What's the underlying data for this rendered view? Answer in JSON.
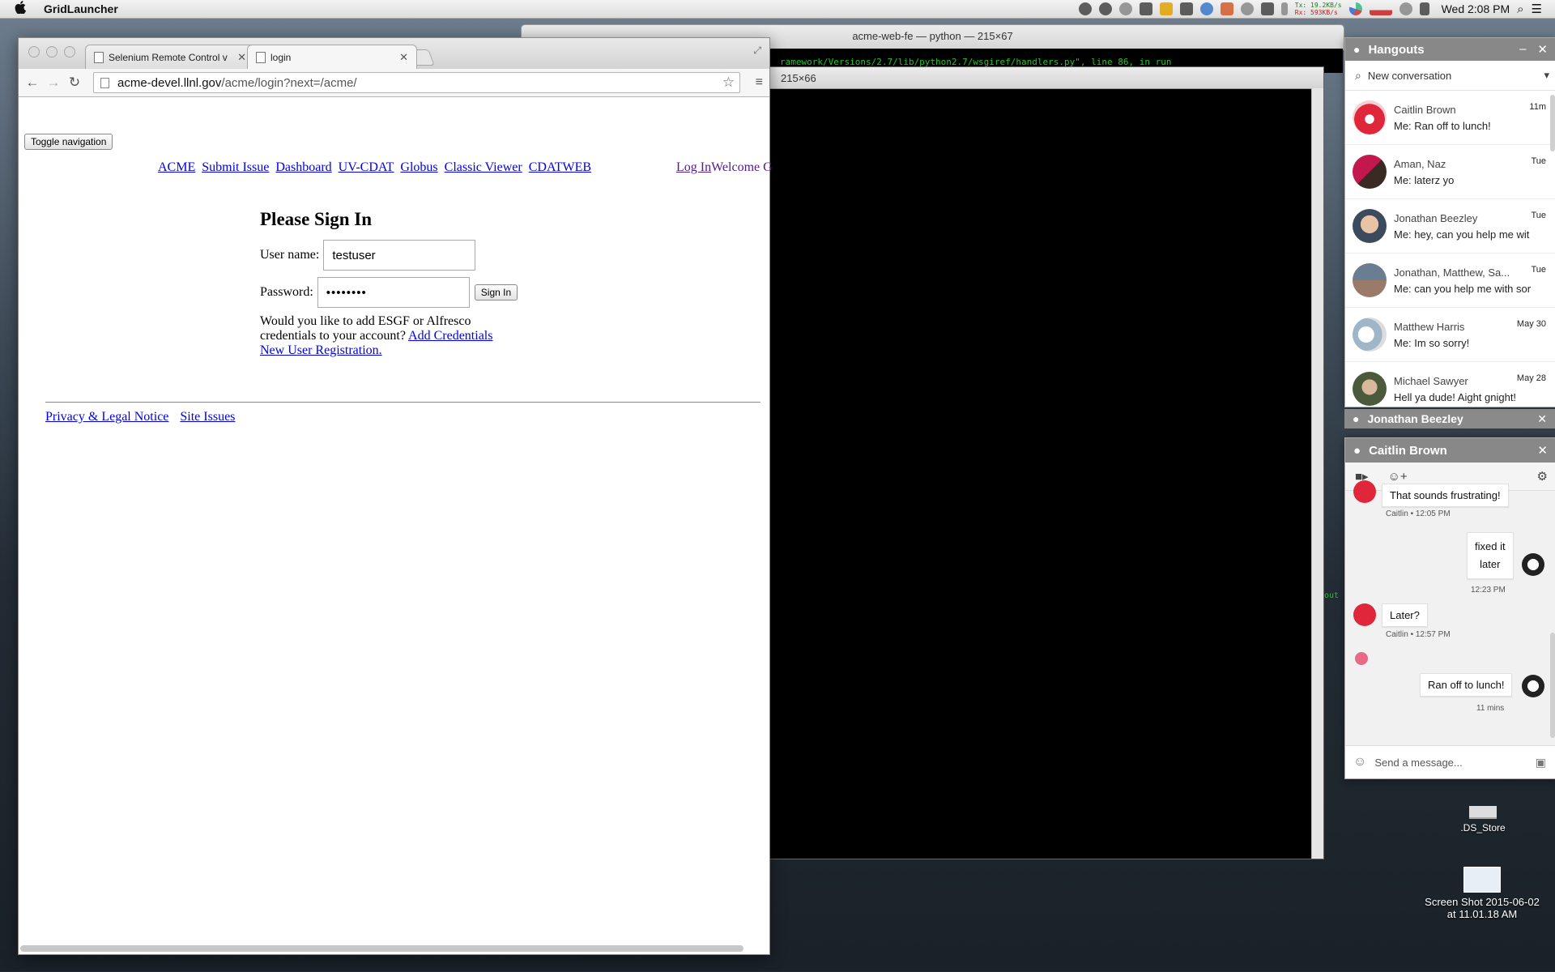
{
  "menubar": {
    "app_name": "GridLauncher",
    "net_tx": "Tx: 19.2KB/s",
    "net_rx": "Rx: 593KB/s",
    "clock": "Wed 2:08 PM"
  },
  "desktop": {
    "ds_store_label": ".DS_Store",
    "screenshot_label_line1": "Screen Shot 2015-06-02",
    "screenshot_label_line2": "at 11.01.18 AM"
  },
  "terminal_back": {
    "title": "acme-web-fe — python — 215×67",
    "line": "ramework/Versions/2.7/lib/python2.7/wsgiref/handlers.py\", line 86, in run"
  },
  "terminal_front": {
    "title": "215×66",
    "stray_text": "out"
  },
  "browser": {
    "tabs": [
      {
        "label": "Selenium Remote Control v"
      },
      {
        "label": "login"
      }
    ],
    "url_host": "acme-devel.llnl.gov",
    "url_path": "/acme/login?next=/acme/",
    "page": {
      "toggle_nav": "Toggle navigation",
      "nav_links": [
        "ACME",
        "Submit Issue",
        "Dashboard",
        "UV-CDAT",
        "Globus",
        "Classic Viewer",
        "CDATWEB"
      ],
      "login_link": "Log In",
      "welcome_text": "Welcome G",
      "heading": "Please Sign In",
      "username_label": "User name:",
      "username_value": "testuser",
      "password_label": "Password:",
      "password_value": "••••••••",
      "signin_button": "Sign In",
      "add_creds_text": "Would you like to add ESGF or Alfresco credentials to your account?",
      "add_creds_link": "Add Credentials",
      "register_link": "New User Registration.",
      "footer_links": [
        "Privacy & Legal Notice",
        "Site Issues"
      ]
    }
  },
  "hangouts": {
    "title": "Hangouts",
    "search_placeholder": "New conversation",
    "conversations": [
      {
        "name": "Caitlin Brown",
        "message": "Me: Ran off to lunch!",
        "time": "11m"
      },
      {
        "name": "Aman, Naz",
        "message": "Me: laterz yo",
        "time": "Tue"
      },
      {
        "name": "Jonathan Beezley",
        "message": "Me: hey, can you help me wit",
        "time": "Tue"
      },
      {
        "name": "Jonathan, Matthew, Sa...",
        "message": "Me: can you help me with sor",
        "time": "Tue"
      },
      {
        "name": "Matthew Harris",
        "message": "Me: Im so sorry!",
        "time": "May 30"
      },
      {
        "name": "Michael Sawyer",
        "message": "Hell ya dude! Aight gnight!",
        "time": "May 28"
      }
    ],
    "minimized_chat": "Jonathan Beezley",
    "chat": {
      "title": "Caitlin Brown",
      "messages": [
        {
          "text": "That sounds frustrating!",
          "meta": "Caitlin • 12:05 PM"
        },
        {
          "text_line1": "fixed it",
          "text_line2": "later",
          "meta": "12:23 PM"
        },
        {
          "text": "Later?",
          "meta": "Caitlin • 12:57 PM"
        },
        {
          "text": "Ran off to lunch!",
          "meta": "11 mins"
        }
      ],
      "input_placeholder": "Send a message..."
    }
  },
  "colors": {
    "link": "#0000ee",
    "visited_link": "#551a8b",
    "hangouts_header": "#888888",
    "terminal_green": "#22c322"
  }
}
